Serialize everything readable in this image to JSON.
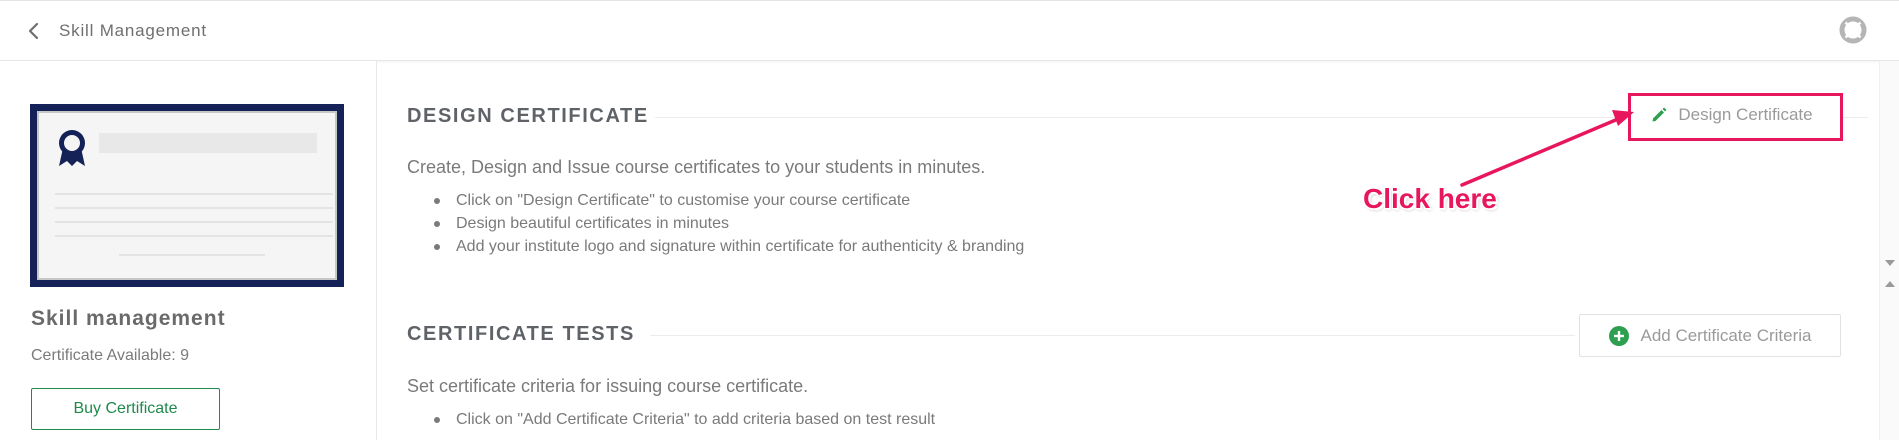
{
  "header": {
    "title": "Skill Management",
    "back_icon": "chevron-left-icon",
    "help_icon": "lifebuoy-icon"
  },
  "sidebar": {
    "title": "Skill management",
    "availability": "Certificate Available: 9",
    "buy_label": "Buy Certificate",
    "colors": {
      "certificate_frame": "#142257",
      "accent": "#1f8a4c"
    }
  },
  "design_section": {
    "heading": "DESIGN CERTIFICATE",
    "button_label": "Design Certificate",
    "button_icon": "pencil-icon",
    "description": "Create, Design and Issue course certificates to your students in minutes.",
    "bullets": [
      "Click on \"Design Certificate\" to customise your course certificate",
      "Design beautiful certificates in minutes",
      "Add your institute logo and signature within certificate for authenticity & branding"
    ]
  },
  "tests_section": {
    "heading": "CERTIFICATE TESTS",
    "button_label": "Add Certificate Criteria",
    "button_icon": "plus-circle-icon",
    "description": "Set certificate criteria for issuing course certificate.",
    "bullets": [
      "Click on \"Add Certificate Criteria\" to add criteria based on test result"
    ]
  },
  "annotation": {
    "text": "Click here",
    "color": "#e8175d"
  }
}
